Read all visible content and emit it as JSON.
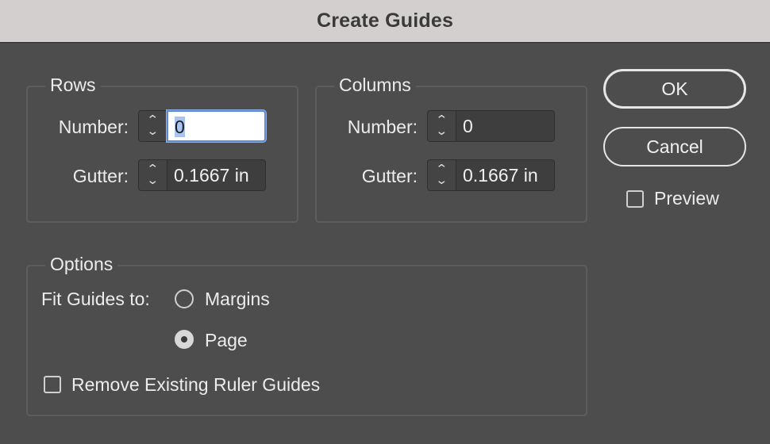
{
  "window": {
    "title": "Create Guides"
  },
  "rows": {
    "label": "Rows",
    "number_label": "Number:",
    "number_value": "0",
    "gutter_label": "Gutter:",
    "gutter_value": "0.1667 in"
  },
  "columns": {
    "label": "Columns",
    "number_label": "Number:",
    "number_value": "0",
    "gutter_label": "Gutter:",
    "gutter_value": "0.1667 in"
  },
  "options": {
    "label": "Options",
    "fit_label": "Fit Guides to:",
    "margins_label": "Margins",
    "page_label": "Page",
    "selected": "Page",
    "remove_label": "Remove Existing Ruler Guides",
    "remove_checked": false
  },
  "buttons": {
    "ok": "OK",
    "cancel": "Cancel"
  },
  "preview": {
    "label": "Preview",
    "checked": false
  },
  "stepper_glyphs": {
    "up": "︿",
    "down": "﹀"
  }
}
